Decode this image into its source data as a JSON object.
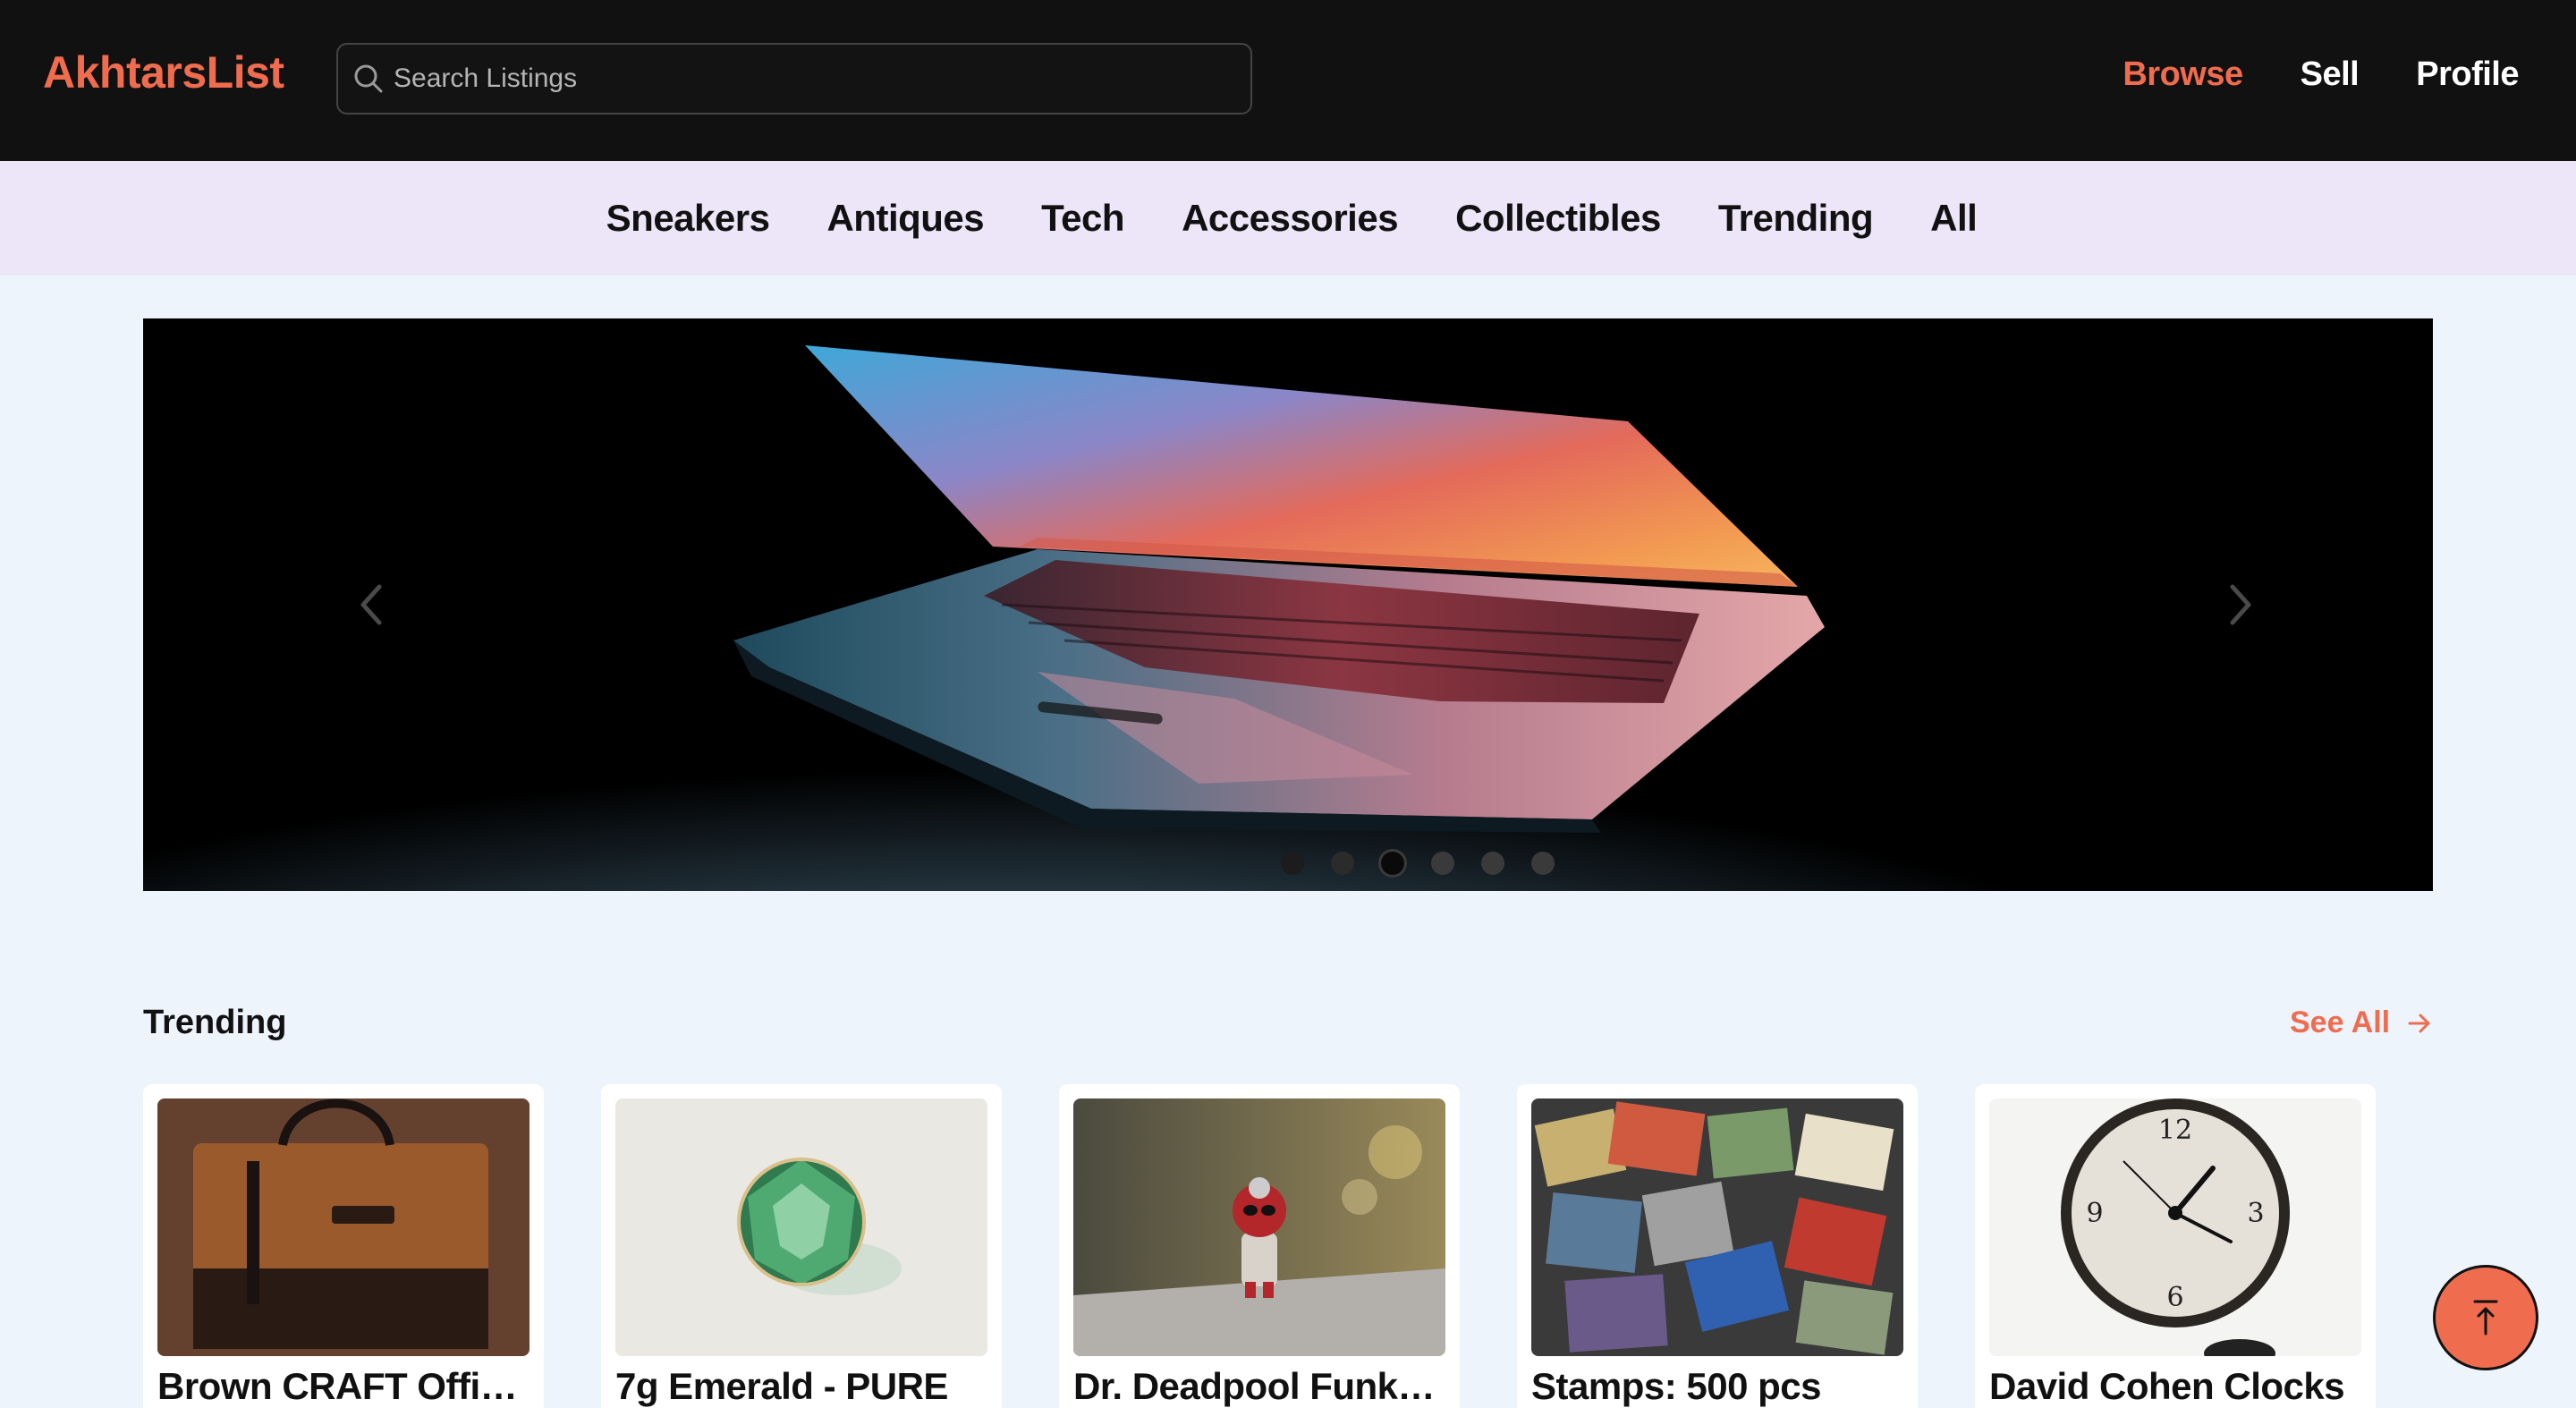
{
  "header": {
    "brand": "AkhtarsList",
    "search_placeholder": "Search Listings",
    "nav": [
      {
        "label": "Browse",
        "active": true
      },
      {
        "label": "Sell",
        "active": false
      },
      {
        "label": "Profile",
        "active": false
      }
    ]
  },
  "categories": [
    "Sneakers",
    "Antiques",
    "Tech",
    "Accessories",
    "Collectibles",
    "Trending",
    "All"
  ],
  "hero": {
    "slide_count": 6,
    "active_slide": 3,
    "icons": {
      "prev": "chevron-left-icon",
      "next": "chevron-right-icon"
    }
  },
  "trending": {
    "title": "Trending",
    "see_all": "See All",
    "items": [
      {
        "title": "Brown CRAFT Office Bag",
        "thumb": "leather-bag"
      },
      {
        "title": "7g Emerald - PURE",
        "thumb": "emerald"
      },
      {
        "title": "Dr. Deadpool Funko Pop",
        "thumb": "funko-figure"
      },
      {
        "title": "Stamps: 500 pcs",
        "thumb": "stamps"
      },
      {
        "title": "David Cohen Clocks",
        "thumb": "wall-clock"
      }
    ]
  },
  "colors": {
    "accent": "#ef6c4f",
    "header_bg": "#111111",
    "category_bg": "#ede5f8",
    "page_bg": "#eef4fb"
  }
}
